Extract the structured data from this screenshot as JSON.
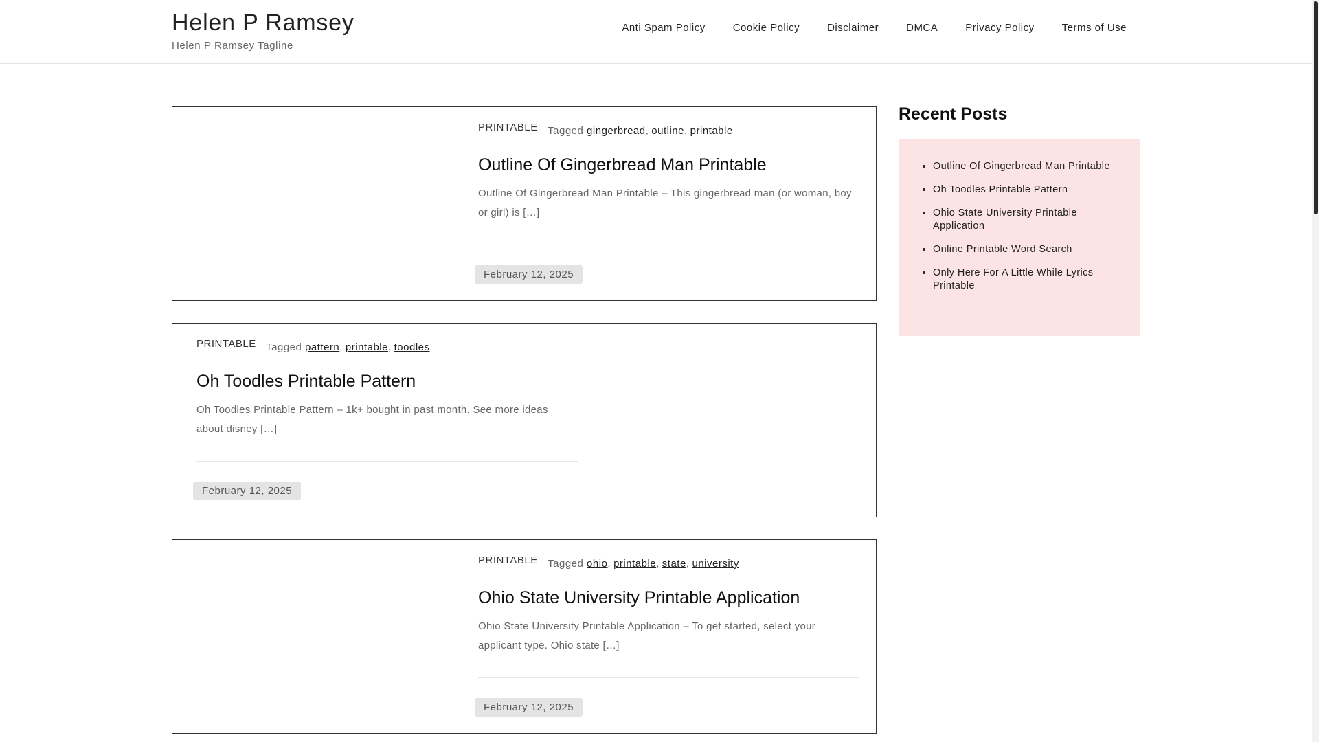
{
  "site": {
    "title": "Helen P Ramsey",
    "tagline": "Helen P Ramsey Tagline"
  },
  "nav": {
    "items": [
      {
        "label": "Anti Spam Policy"
      },
      {
        "label": "Cookie Policy"
      },
      {
        "label": "Disclaimer"
      },
      {
        "label": "DMCA"
      },
      {
        "label": "Privacy Policy"
      },
      {
        "label": "Terms of Use"
      }
    ]
  },
  "posts": [
    {
      "category": "PRINTABLE",
      "tagged_label": "Tagged",
      "tags": [
        "gingerbread",
        "outline",
        "printable"
      ],
      "title": "Outline Of Gingerbread Man Printable",
      "excerpt": "Outline Of Gingerbread Man Printable – This gingerbread man (or woman, boy or girl) is […]",
      "date": "February 12, 2025"
    },
    {
      "category": "PRINTABLE",
      "tagged_label": "Tagged",
      "tags": [
        "pattern",
        "printable",
        "toodles"
      ],
      "title": "Oh Toodles Printable Pattern",
      "excerpt": "Oh Toodles Printable Pattern – 1k+ bought in past month. See more ideas about disney […]",
      "date": "February 12, 2025"
    },
    {
      "category": "PRINTABLE",
      "tagged_label": "Tagged",
      "tags": [
        "ohio",
        "printable",
        "state",
        "university"
      ],
      "title": "Ohio State University Printable Application",
      "excerpt": "Ohio State University Printable Application – To get started, select your applicant type. Ohio state […]",
      "date": "February 12, 2025"
    }
  ],
  "sidebar": {
    "title": "Recent Posts",
    "items": [
      {
        "label": "Outline Of Gingerbread Man Printable"
      },
      {
        "label": "Oh Toodles Printable Pattern"
      },
      {
        "label": "Ohio State University Printable Application"
      },
      {
        "label": "Online Printable Word Search"
      },
      {
        "label": "Only Here For A Little While Lyrics Printable"
      }
    ]
  }
}
